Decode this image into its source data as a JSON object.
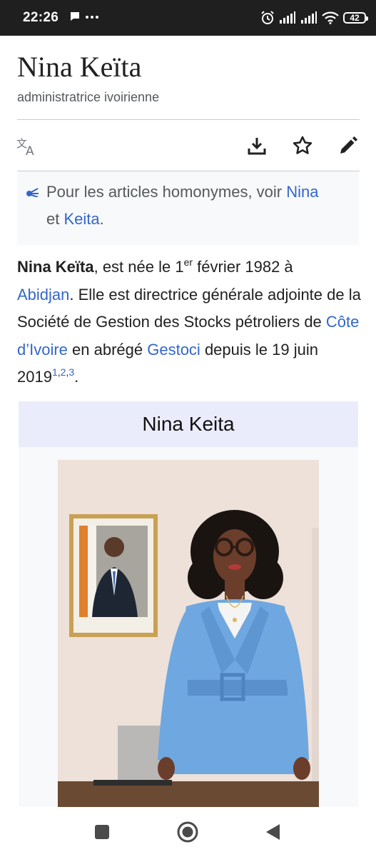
{
  "status_bar": {
    "time": "22:26",
    "notification_icons": [
      "chat-bubble-icon",
      "more-dots-icon"
    ],
    "system_icons": [
      "alarm-icon",
      "signal-icon",
      "signal-icon",
      "wifi-icon"
    ],
    "battery": "42"
  },
  "article": {
    "title": "Nina Keïta",
    "description": "administratrice ivoirienne"
  },
  "toolbar": {
    "icons": [
      "translate-icon",
      "download-icon",
      "star-icon",
      "edit-pencil-icon"
    ]
  },
  "hatnote": {
    "prefix": "Pour les articles homonymes, voir ",
    "link1": "Nina",
    "middle": " et ",
    "link2": "Keita",
    "suffix": "."
  },
  "intro": {
    "name": "Nina Keïta",
    "t1": ", est née le 1",
    "sup_er": "er",
    "t2": " février 1982 à ",
    "link_city": "Abidjan",
    "t3": ". Elle est directrice générale adjointe de la Société de Gestion des Stocks pétroliers de ",
    "link_country": "Côte d’Ivoire",
    "t4": " en abrégé ",
    "link_company": "Gestoci",
    "t5": " depuis le 19 juin 2019",
    "refs": [
      "1",
      "2",
      "3"
    ],
    "t6": "."
  },
  "infobox": {
    "title": "Nina Keita"
  },
  "nav_bar": {
    "icons": [
      "recents-square-icon",
      "home-circle-icon",
      "back-triangle-icon"
    ]
  },
  "colors": {
    "link": "#3366cc",
    "status_bar_bg": "#1f1f1f",
    "infobox_header": "#eaecfc",
    "suit_blue": "#6fa7e0"
  }
}
